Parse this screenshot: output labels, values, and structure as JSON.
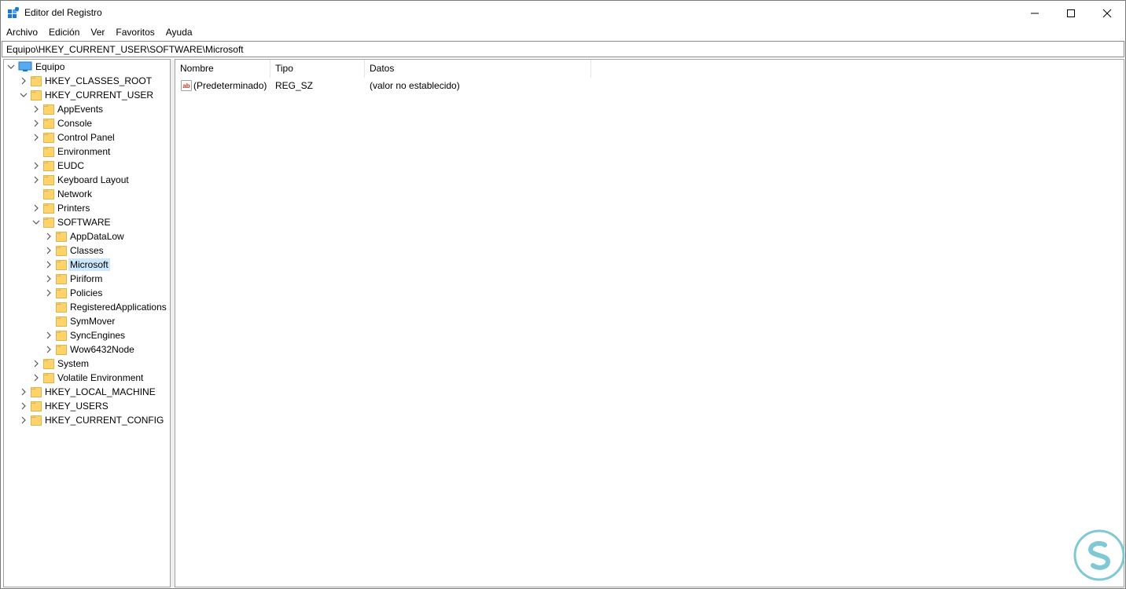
{
  "window": {
    "title": "Editor del Registro",
    "icon": "registry-editor-icon"
  },
  "menu": [
    "Archivo",
    "Edición",
    "Ver",
    "Favoritos",
    "Ayuda"
  ],
  "address": "Equipo\\HKEY_CURRENT_USER\\SOFTWARE\\Microsoft",
  "tree": {
    "root": "Equipo",
    "items": [
      {
        "label": "HKEY_CLASSES_ROOT",
        "expander": "collapsed",
        "level": 1
      },
      {
        "label": "HKEY_CURRENT_USER",
        "expander": "expanded",
        "level": 1
      },
      {
        "label": "AppEvents",
        "expander": "collapsed",
        "level": 2
      },
      {
        "label": "Console",
        "expander": "collapsed",
        "level": 2
      },
      {
        "label": "Control Panel",
        "expander": "collapsed",
        "level": 2
      },
      {
        "label": "Environment",
        "expander": "none",
        "level": 2
      },
      {
        "label": "EUDC",
        "expander": "collapsed",
        "level": 2
      },
      {
        "label": "Keyboard Layout",
        "expander": "collapsed",
        "level": 2
      },
      {
        "label": "Network",
        "expander": "none",
        "level": 2
      },
      {
        "label": "Printers",
        "expander": "collapsed",
        "level": 2
      },
      {
        "label": "SOFTWARE",
        "expander": "expanded",
        "level": 2
      },
      {
        "label": "AppDataLow",
        "expander": "collapsed",
        "level": 3
      },
      {
        "label": "Classes",
        "expander": "collapsed",
        "level": 3
      },
      {
        "label": "Microsoft",
        "expander": "collapsed",
        "level": 3,
        "selected": true
      },
      {
        "label": "Piriform",
        "expander": "collapsed",
        "level": 3
      },
      {
        "label": "Policies",
        "expander": "collapsed",
        "level": 3
      },
      {
        "label": "RegisteredApplications",
        "expander": "none",
        "level": 3
      },
      {
        "label": "SymMover",
        "expander": "none",
        "level": 3
      },
      {
        "label": "SyncEngines",
        "expander": "collapsed",
        "level": 3
      },
      {
        "label": "Wow6432Node",
        "expander": "collapsed",
        "level": 3
      },
      {
        "label": "System",
        "expander": "collapsed",
        "level": 2
      },
      {
        "label": "Volatile Environment",
        "expander": "collapsed",
        "level": 2
      },
      {
        "label": "HKEY_LOCAL_MACHINE",
        "expander": "collapsed",
        "level": 1
      },
      {
        "label": "HKEY_USERS",
        "expander": "collapsed",
        "level": 1
      },
      {
        "label": "HKEY_CURRENT_CONFIG",
        "expander": "collapsed",
        "level": 1
      }
    ]
  },
  "list": {
    "columns": {
      "name": "Nombre",
      "type": "Tipo",
      "data": "Datos"
    },
    "rows": [
      {
        "name": "(Predeterminado)",
        "type": "REG_SZ",
        "data": "(valor no establecido)",
        "icon": "string-value-icon"
      }
    ]
  },
  "colors": {
    "selection": "#cce8ff",
    "folder": "#ffd36b",
    "value_icon": "#c8371b",
    "logo": "#7fc8d4"
  }
}
